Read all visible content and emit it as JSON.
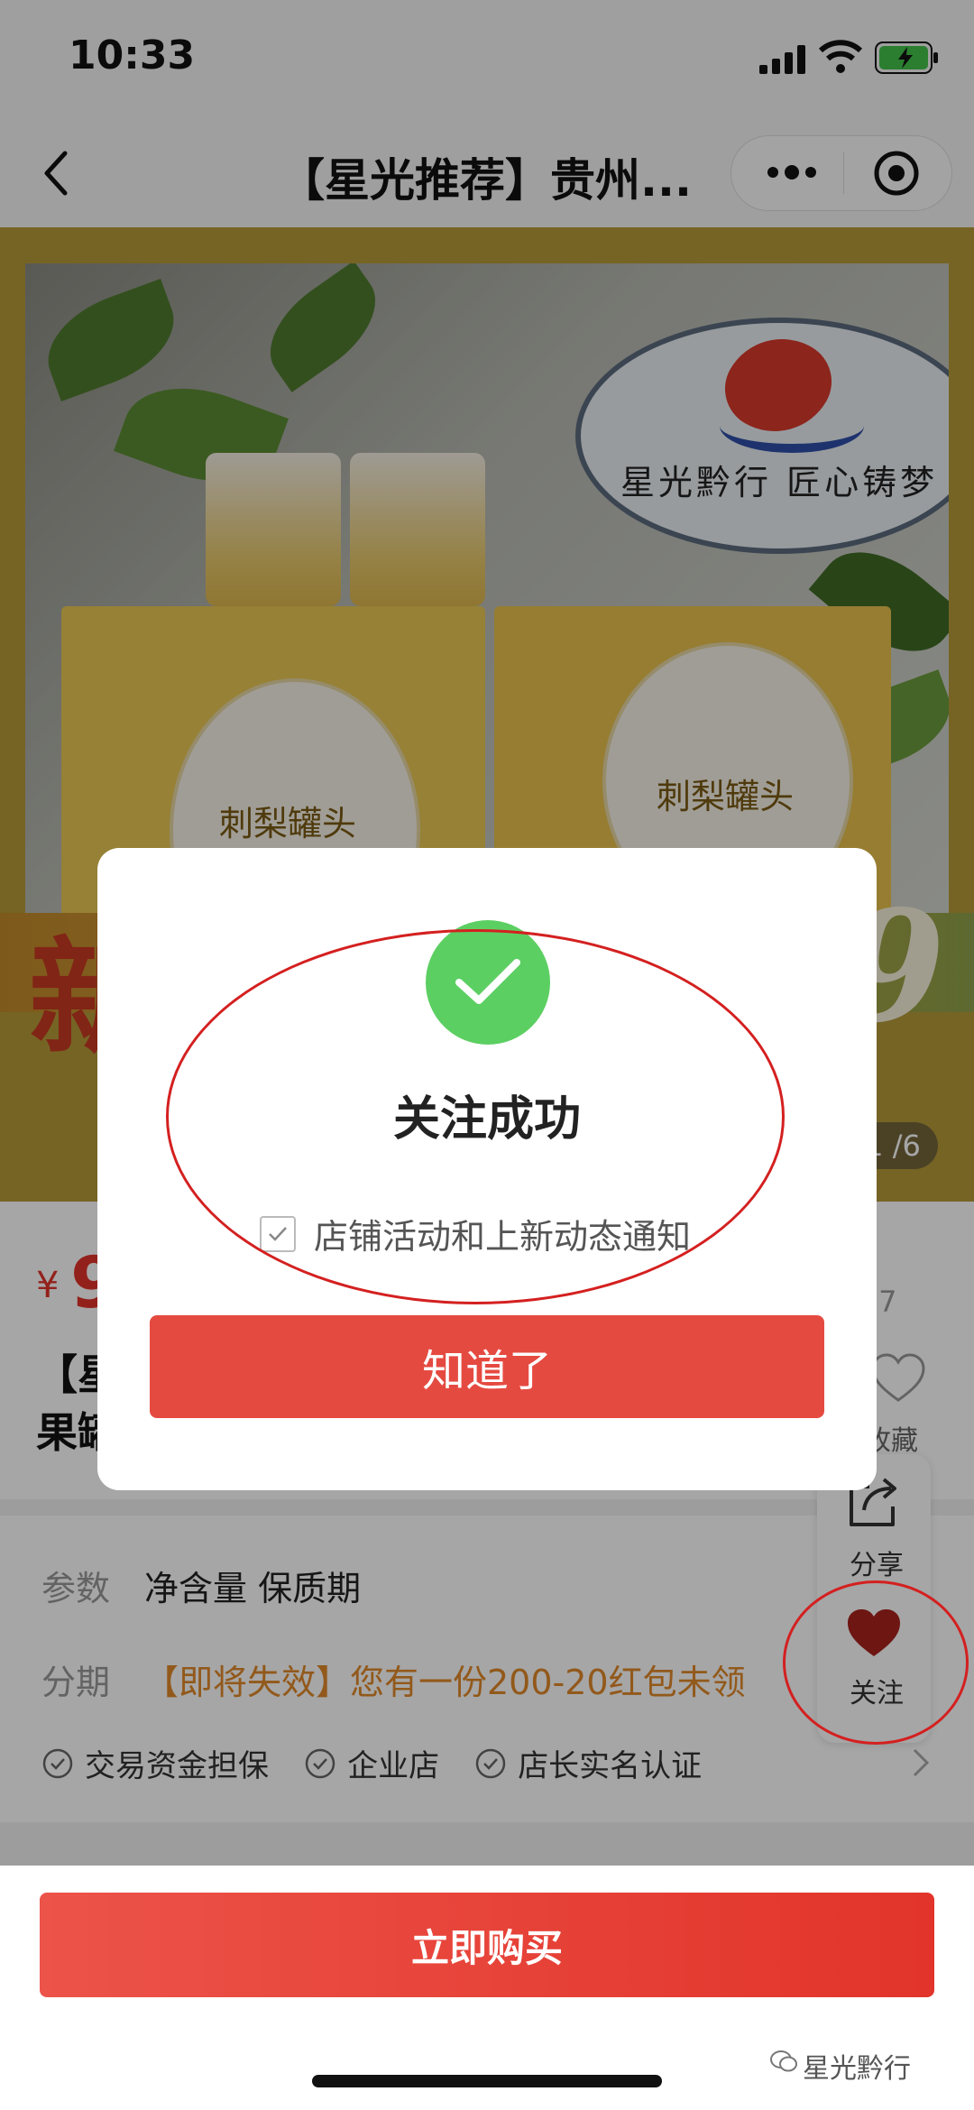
{
  "status_bar": {
    "time": "10:33"
  },
  "nav": {
    "title": "【星光推荐】贵州..."
  },
  "banner": {
    "bubble_text": "星光黔行 匠心铸梦",
    "box_label": "刺梨罐头",
    "new_char": "新",
    "big_digit": "9",
    "pager": "1 /6"
  },
  "product": {
    "currency": "¥",
    "price": "9",
    "title_line1": "【星",
    "title_line2": "果罐",
    "sales": "销量 7",
    "fav_label": "收藏"
  },
  "details": {
    "params_label": "参数",
    "params_value": "净含量 保质期",
    "installment_label": "分期",
    "installment_value": "【即将失效】您有一份200-20红包未领",
    "badges": [
      "交易资金担保",
      "企业店",
      "店长实名认证"
    ]
  },
  "floating": {
    "share_label": "分享",
    "follow_label": "关注"
  },
  "bottom": {
    "buy_label": "立即购买",
    "watermark": "星光黔行"
  },
  "dialog": {
    "title": "关注成功",
    "notify_label": "店铺活动和上新动态通知",
    "notify_checked": true,
    "ok_label": "知道了"
  },
  "colors": {
    "accent": "#e2342a",
    "success": "#5ccf62",
    "promo": "#e0892a"
  }
}
